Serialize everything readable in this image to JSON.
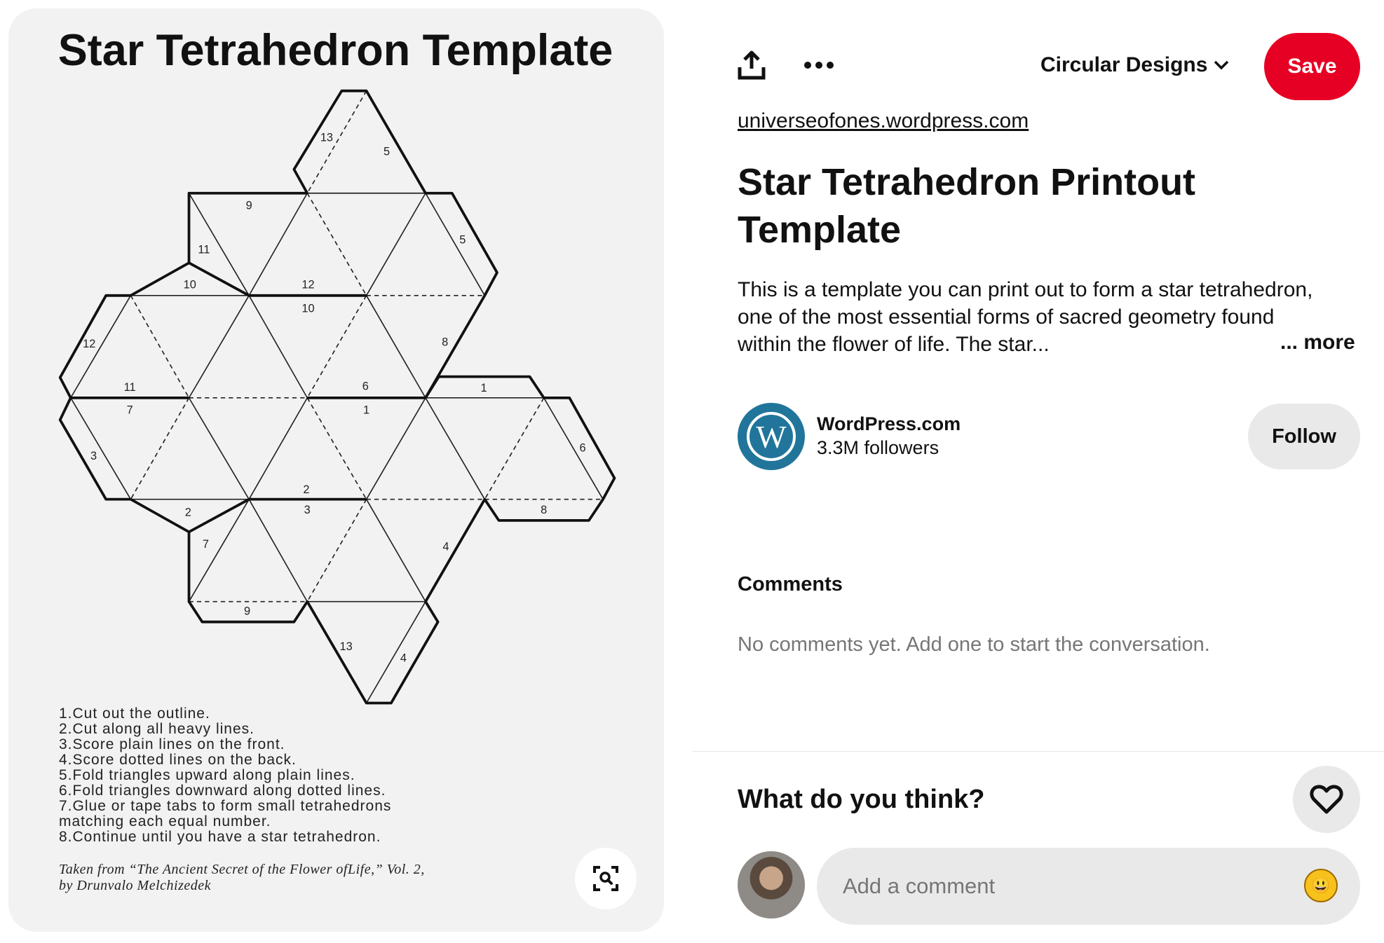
{
  "pin_image": {
    "title": "Star Tetrahedron Template",
    "labels": [
      "13",
      "5",
      "9",
      "5",
      "11",
      "10",
      "12",
      "10",
      "12",
      "8",
      "11",
      "6",
      "1",
      "7",
      "1",
      "3",
      "6",
      "2",
      "3",
      "2",
      "8",
      "7",
      "4",
      "9",
      "13",
      "4"
    ],
    "instructions": [
      "1.Cut out the outline.",
      "2.Cut along all heavy lines.",
      "3.Score plain lines on the front.",
      "4.Score dotted lines on the back.",
      "5.Fold triangles upward along plain lines.",
      "6.Fold triangles downward along dotted lines.",
      "7.Glue or tape tabs to form small tetrahedrons",
      "matching each equal number.",
      "8.Continue until you have a star tetrahedron."
    ],
    "citation": [
      "Taken from “The Ancient Secret of the Flower ofLife,” Vol. 2,",
      "by Drunvalo Melchizedek"
    ],
    "lens_icon": "visual-search-icon"
  },
  "toolbar": {
    "share_icon": "share-icon",
    "more_icon": "more-icon",
    "board": "Circular Designs",
    "save": "Save",
    "save_color": "#e60023"
  },
  "pin": {
    "link": "universeofones.wordpress.com",
    "title": "Star Tetrahedron Printout Template",
    "description": "This is a template you can print out to form a star tetrahedron, one of the most essential forms of sacred geometry found within the flower of life. The star...",
    "more": "... more"
  },
  "creator": {
    "name": "WordPress.com",
    "followers": "3.3M followers",
    "follow": "Follow",
    "avatar_color": "#21759b"
  },
  "comments": {
    "heading": "Comments",
    "empty": "No comments yet. Add one to start the conversation."
  },
  "feedback": {
    "prompt": "What do you think?",
    "input_placeholder": "Add a comment",
    "emoji": "😃"
  }
}
